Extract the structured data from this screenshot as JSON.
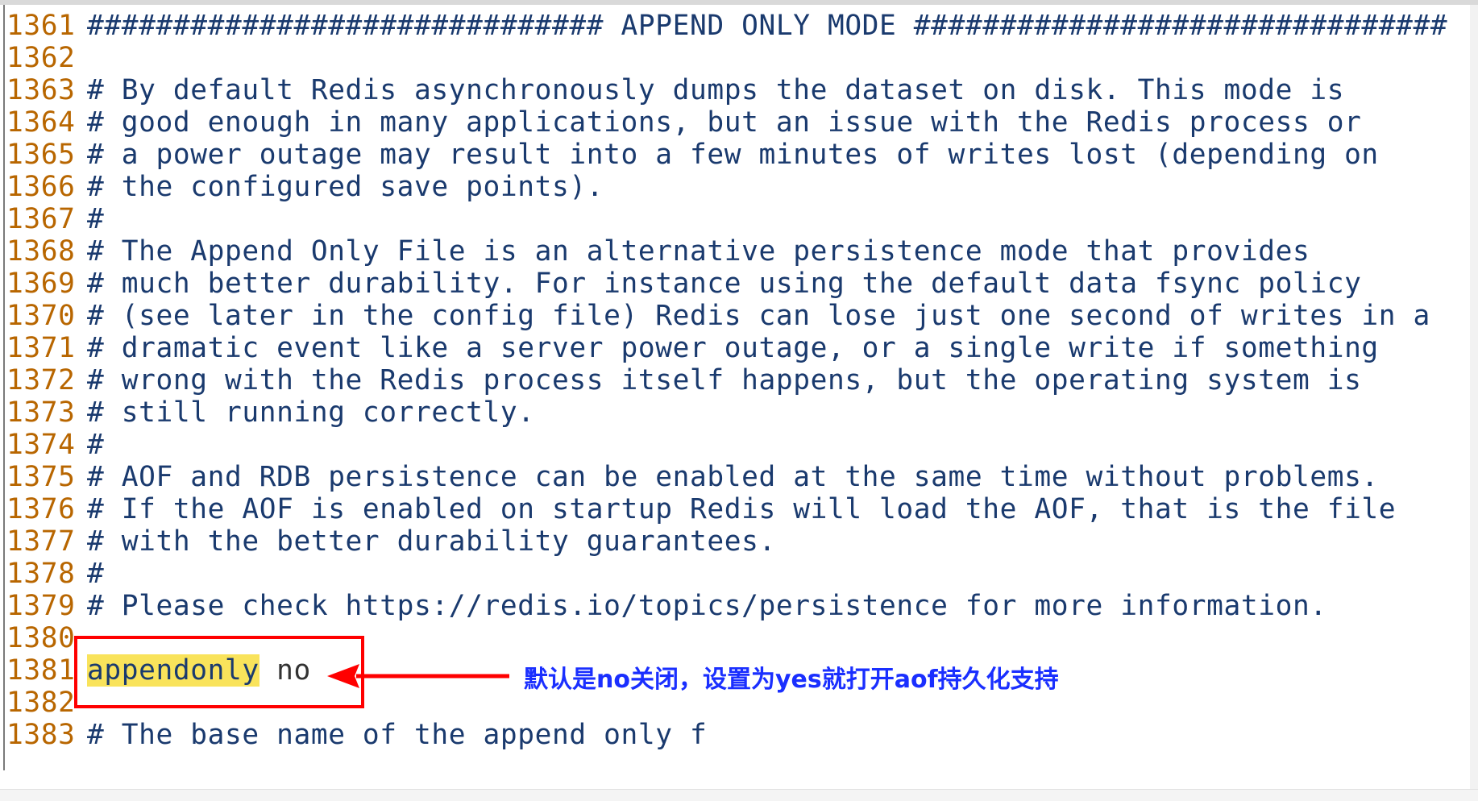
{
  "editor": {
    "lines": [
      {
        "num": "1361",
        "text": "############################## APPEND ONLY MODE ###############################"
      },
      {
        "num": "1362",
        "text": ""
      },
      {
        "num": "1363",
        "text": "# By default Redis asynchronously dumps the dataset on disk. This mode is"
      },
      {
        "num": "1364",
        "text": "# good enough in many applications, but an issue with the Redis process or"
      },
      {
        "num": "1365",
        "text": "# a power outage may result into a few minutes of writes lost (depending on"
      },
      {
        "num": "1366",
        "text": "# the configured save points)."
      },
      {
        "num": "1367",
        "text": "#"
      },
      {
        "num": "1368",
        "text": "# The Append Only File is an alternative persistence mode that provides"
      },
      {
        "num": "1369",
        "text": "# much better durability. For instance using the default data fsync policy"
      },
      {
        "num": "1370",
        "text": "# (see later in the config file) Redis can lose just one second of writes in a"
      },
      {
        "num": "1371",
        "text": "# dramatic event like a server power outage, or a single write if something"
      },
      {
        "num": "1372",
        "text": "# wrong with the Redis process itself happens, but the operating system is"
      },
      {
        "num": "1373",
        "text": "# still running correctly."
      },
      {
        "num": "1374",
        "text": "#"
      },
      {
        "num": "1375",
        "text": "# AOF and RDB persistence can be enabled at the same time without problems."
      },
      {
        "num": "1376",
        "text": "# If the AOF is enabled on startup Redis will load the AOF, that is the file"
      },
      {
        "num": "1377",
        "text": "# with the better durability guarantees."
      },
      {
        "num": "1378",
        "text": "#"
      },
      {
        "num": "1379",
        "text": "# Please check https://redis.io/topics/persistence for more information."
      },
      {
        "num": "1380",
        "text": ""
      },
      {
        "num": "1381",
        "keyword": "appendonly",
        "value": " no"
      },
      {
        "num": "1382",
        "text": ""
      },
      {
        "num": "1383",
        "text": "# The base name of the append only f"
      }
    ]
  },
  "annotation": {
    "text": "默认是no关闭，设置为yes就打开aof持久化支持"
  },
  "colors": {
    "line_number": "#b86600",
    "comment": "#1a3a6e",
    "highlight": "#f9e35b",
    "callout_red": "#ff0000",
    "annotation_blue": "#1a2fff"
  }
}
